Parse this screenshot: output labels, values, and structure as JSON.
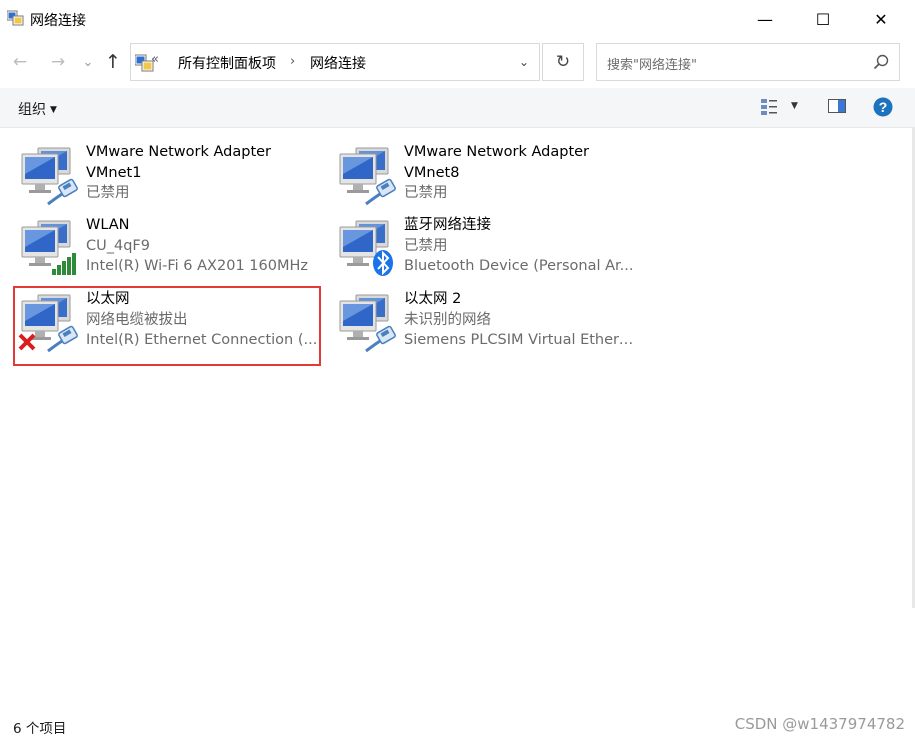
{
  "window": {
    "title": "网络连接",
    "minimize_glyph": "—",
    "maximize_glyph": "☐",
    "close_glyph": "✕"
  },
  "nav": {
    "back_glyph": "←",
    "forward_glyph": "→",
    "recent_glyph": "⌄",
    "up_glyph": "↑"
  },
  "address": {
    "overflow_glyph": "«",
    "breadcrumbs": [
      "所有控制面板项",
      "网络连接"
    ],
    "separator": "›",
    "dropdown_glyph": "⌄",
    "refresh_glyph": "↻"
  },
  "search": {
    "placeholder": "搜索\"网络连接\""
  },
  "toolbar": {
    "organize_label": "组织",
    "caret_glyph": "▼",
    "help_glyph": "?"
  },
  "connections": [
    {
      "name": "VMware Network Adapter",
      "line2": "VMnet1",
      "line3": "已禁用",
      "icon": "network-adapter-cable",
      "status": "disabled"
    },
    {
      "name": "VMware Network Adapter",
      "line2": "VMnet8",
      "line3": "已禁用",
      "icon": "network-adapter-cable",
      "status": "disabled"
    },
    {
      "name": "WLAN",
      "line2": "CU_4qF9",
      "line3": "Intel(R) Wi-Fi 6 AX201 160MHz",
      "icon": "wifi-adapter",
      "status": "connected"
    },
    {
      "name": "蓝牙网络连接",
      "line2": "已禁用",
      "line3": "Bluetooth Device (Personal Ar...",
      "icon": "bluetooth-adapter",
      "status": "disabled"
    },
    {
      "name": "以太网",
      "line2": "网络电缆被拔出",
      "line3": "Intel(R) Ethernet Connection (...",
      "icon": "ethernet-unplugged",
      "status": "unplugged"
    },
    {
      "name": "以太网 2",
      "line2": "未识别的网络",
      "line3": "Siemens PLCSIM Virtual Ethern...",
      "icon": "network-adapter-cable",
      "status": "unidentified"
    }
  ],
  "status_bar": {
    "count_text": "6 个项目"
  },
  "watermark": "CSDN @w1437974782",
  "colors": {
    "highlight": "#e53935",
    "help_blue": "#1e73be",
    "signal_green": "#2e8b3a",
    "bluetooth_blue": "#1a73e8",
    "error_red": "#d81e1e"
  }
}
